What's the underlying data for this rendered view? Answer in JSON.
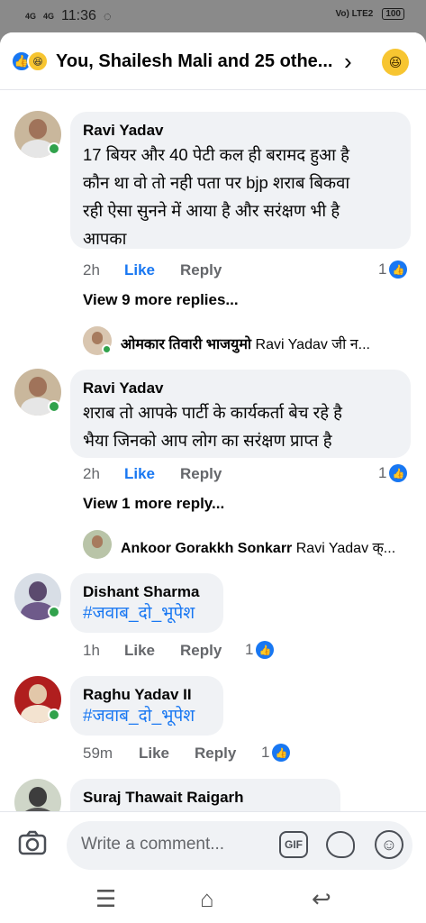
{
  "status_bar": {
    "signal1": "4G",
    "signal2": "4G",
    "time": "11:36",
    "network": "Vo) LTE2",
    "battery": "100"
  },
  "header": {
    "title": "You, Shailesh Mali and 25 othe..."
  },
  "comments": [
    {
      "author": "Ravi Yadav",
      "text_lines": [
        "17 बियर और 40 पेटी कल ही बरामद हुआ है",
        "कौन था वो तो नही पता पर bjp शराब बिकवा",
        "रही ऐसा सुनने में आया है और सरंक्षण भी है",
        "आपका"
      ],
      "time": "2h",
      "like": "Like",
      "reply": "Reply",
      "likes": "1",
      "view_more": "View 9 more replies...",
      "reply_preview_author": "ओमकार तिवारी भाजयुमो",
      "reply_preview_text": "Ravi Yadav जी न..."
    },
    {
      "author": "Ravi Yadav",
      "text_lines": [
        "शराब तो आपके पार्टी के कार्यकर्ता बेच रहे है",
        "भैया जिनको आप लोग का सरंक्षण प्राप्त है"
      ],
      "time": "2h",
      "like": "Like",
      "reply": "Reply",
      "likes": "1",
      "view_more": "View 1 more reply...",
      "reply_preview_author": "Ankoor Gorakkh Sonkarr",
      "reply_preview_text": "Ravi Yadav क्..."
    },
    {
      "author": "Dishant Sharma",
      "text": "#जवाब_दो_भूपेश",
      "time": "1h",
      "like": "Like",
      "reply": "Reply",
      "likes": "1"
    },
    {
      "author": "Raghu Yadav II",
      "text": "#जवाब_दो_भूपेश",
      "time": "59m",
      "like": "Like",
      "reply": "Reply",
      "likes": "1"
    },
    {
      "author": "Suraj Thawait Raigarh"
    }
  ],
  "composer": {
    "placeholder": "Write a comment...",
    "gif_label": "GIF"
  },
  "colors": {
    "accent": "#1877f2",
    "online": "#31a24c",
    "bubble": "#f0f2f5"
  }
}
